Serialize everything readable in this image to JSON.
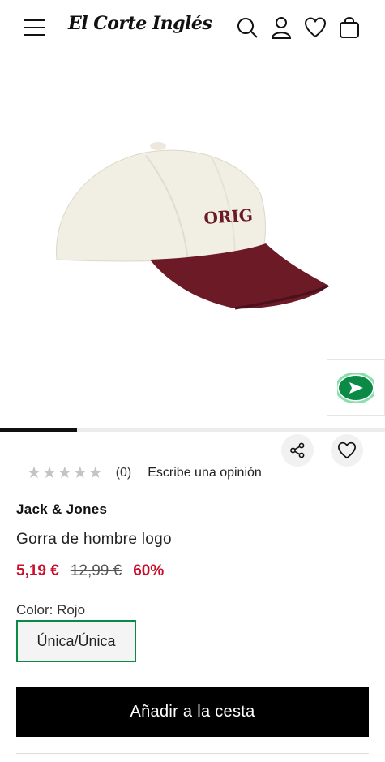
{
  "header": {
    "logo_text": "El Corte Inglés",
    "icons": [
      "menu-icon",
      "search-icon",
      "user-icon",
      "heart-icon",
      "bag-icon"
    ]
  },
  "gallery": {
    "image_text": "ORIG",
    "gallery_progress": 0.2,
    "icons": [
      "chat-icon",
      "share-icon",
      "heart-icon"
    ]
  },
  "rating": {
    "stars": [
      "★",
      "★",
      "★",
      "★",
      "★"
    ],
    "count": "(0)",
    "review_link": "Escribe una opinión"
  },
  "product": {
    "brand": "Jack & Jones",
    "name": "Gorra de hombre logo",
    "price_now": "5,19 €",
    "price_old": "12,99 €",
    "discount": "60%"
  },
  "options": {
    "color_label": "Color: Rojo",
    "size": "Única/Única"
  },
  "cart": {
    "add_label": "Añadir a la cesta"
  },
  "colors": {
    "accent_green": "#0b8a45",
    "sale_red": "#c8102e",
    "cap_crown": "#f1eee4",
    "cap_brim": "#6b1a26"
  }
}
